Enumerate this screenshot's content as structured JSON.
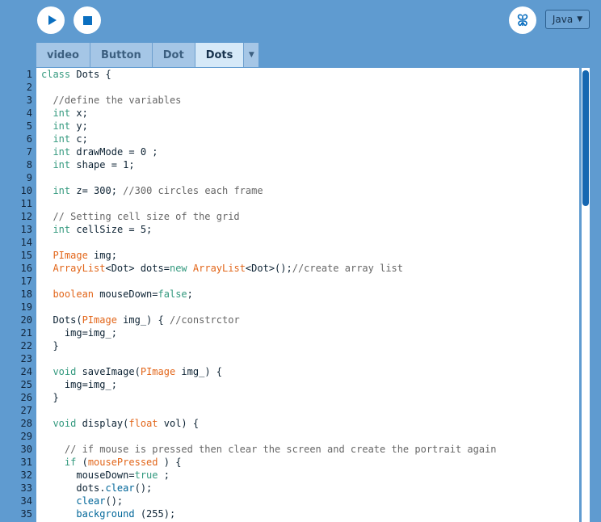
{
  "toolbar": {
    "play_icon": "play-icon",
    "stop_icon": "stop-icon",
    "mode_icon": "butterfly-icon",
    "mode_label": "Java",
    "mode_caret": "▼"
  },
  "tabs": [
    {
      "label": "video",
      "active": false
    },
    {
      "label": "Button",
      "active": false
    },
    {
      "label": "Dot",
      "active": false
    },
    {
      "label": "Dots",
      "active": true
    }
  ],
  "tab_menu_caret": "▼",
  "colors": {
    "background": "#5f9bd0",
    "keyword": "#33997e",
    "type": "#e2661a",
    "comment": "#666666",
    "function": "#006699",
    "scroll_thumb": "#1667b1"
  },
  "code_lines": [
    [
      [
        "kw",
        "class"
      ],
      [
        "pl",
        " Dots {"
      ]
    ],
    [],
    [
      [
        "cm",
        "  //define the variables"
      ]
    ],
    [
      [
        "pl",
        "  "
      ],
      [
        "kw",
        "int"
      ],
      [
        "pl",
        " x;"
      ]
    ],
    [
      [
        "pl",
        "  "
      ],
      [
        "kw",
        "int"
      ],
      [
        "pl",
        " y;"
      ]
    ],
    [
      [
        "pl",
        "  "
      ],
      [
        "kw",
        "int"
      ],
      [
        "pl",
        " c;"
      ]
    ],
    [
      [
        "pl",
        "  "
      ],
      [
        "kw",
        "int"
      ],
      [
        "pl",
        " drawMode = 0 ;"
      ]
    ],
    [
      [
        "pl",
        "  "
      ],
      [
        "kw",
        "int"
      ],
      [
        "pl",
        " shape = 1;"
      ]
    ],
    [],
    [
      [
        "pl",
        "  "
      ],
      [
        "kw",
        "int"
      ],
      [
        "pl",
        " z= 300; "
      ],
      [
        "cm",
        "//300 circles each frame"
      ]
    ],
    [],
    [
      [
        "cm",
        "  // Setting cell size of the grid"
      ]
    ],
    [
      [
        "pl",
        "  "
      ],
      [
        "kw",
        "int"
      ],
      [
        "pl",
        " cellSize = 5;"
      ]
    ],
    [],
    [
      [
        "pl",
        "  "
      ],
      [
        "type",
        "PImage"
      ],
      [
        "pl",
        " img;"
      ]
    ],
    [
      [
        "pl",
        "  "
      ],
      [
        "type",
        "ArrayList"
      ],
      [
        "pl",
        "<Dot> dots="
      ],
      [
        "kw",
        "new"
      ],
      [
        "pl",
        " "
      ],
      [
        "type",
        "ArrayList"
      ],
      [
        "pl",
        "<Dot>();"
      ],
      [
        "cm",
        "//create array list"
      ]
    ],
    [],
    [
      [
        "pl",
        "  "
      ],
      [
        "type",
        "boolean"
      ],
      [
        "pl",
        " mouseDown="
      ],
      [
        "kw",
        "false"
      ],
      [
        "pl",
        ";"
      ]
    ],
    [],
    [
      [
        "pl",
        "  Dots("
      ],
      [
        "type",
        "PImage"
      ],
      [
        "pl",
        " img_) { "
      ],
      [
        "cm",
        "//constrctor"
      ]
    ],
    [
      [
        "pl",
        "    img=img_;"
      ]
    ],
    [
      [
        "pl",
        "  }"
      ]
    ],
    [],
    [
      [
        "pl",
        "  "
      ],
      [
        "kw",
        "void"
      ],
      [
        "pl",
        " saveImage("
      ],
      [
        "type",
        "PImage"
      ],
      [
        "pl",
        " img_) {"
      ]
    ],
    [
      [
        "pl",
        "    img=img_;"
      ]
    ],
    [
      [
        "pl",
        "  }"
      ]
    ],
    [],
    [
      [
        "pl",
        "  "
      ],
      [
        "kw",
        "void"
      ],
      [
        "pl",
        " display("
      ],
      [
        "type",
        "float"
      ],
      [
        "pl",
        " vol) {"
      ]
    ],
    [],
    [
      [
        "cm",
        "    // if mouse is pressed then clear the screen and create the portrait again"
      ]
    ],
    [
      [
        "pl",
        "    "
      ],
      [
        "kw",
        "if"
      ],
      [
        "pl",
        " ("
      ],
      [
        "type",
        "mousePressed"
      ],
      [
        "pl",
        " ) {"
      ]
    ],
    [
      [
        "pl",
        "      mouseDown="
      ],
      [
        "kw",
        "true"
      ],
      [
        "pl",
        " ;"
      ]
    ],
    [
      [
        "pl",
        "      dots."
      ],
      [
        "fn",
        "clear"
      ],
      [
        "pl",
        "();"
      ]
    ],
    [
      [
        "pl",
        "      "
      ],
      [
        "fn",
        "clear"
      ],
      [
        "pl",
        "();"
      ]
    ],
    [
      [
        "pl",
        "      "
      ],
      [
        "fn",
        "background"
      ],
      [
        "pl",
        " (255);"
      ]
    ]
  ]
}
